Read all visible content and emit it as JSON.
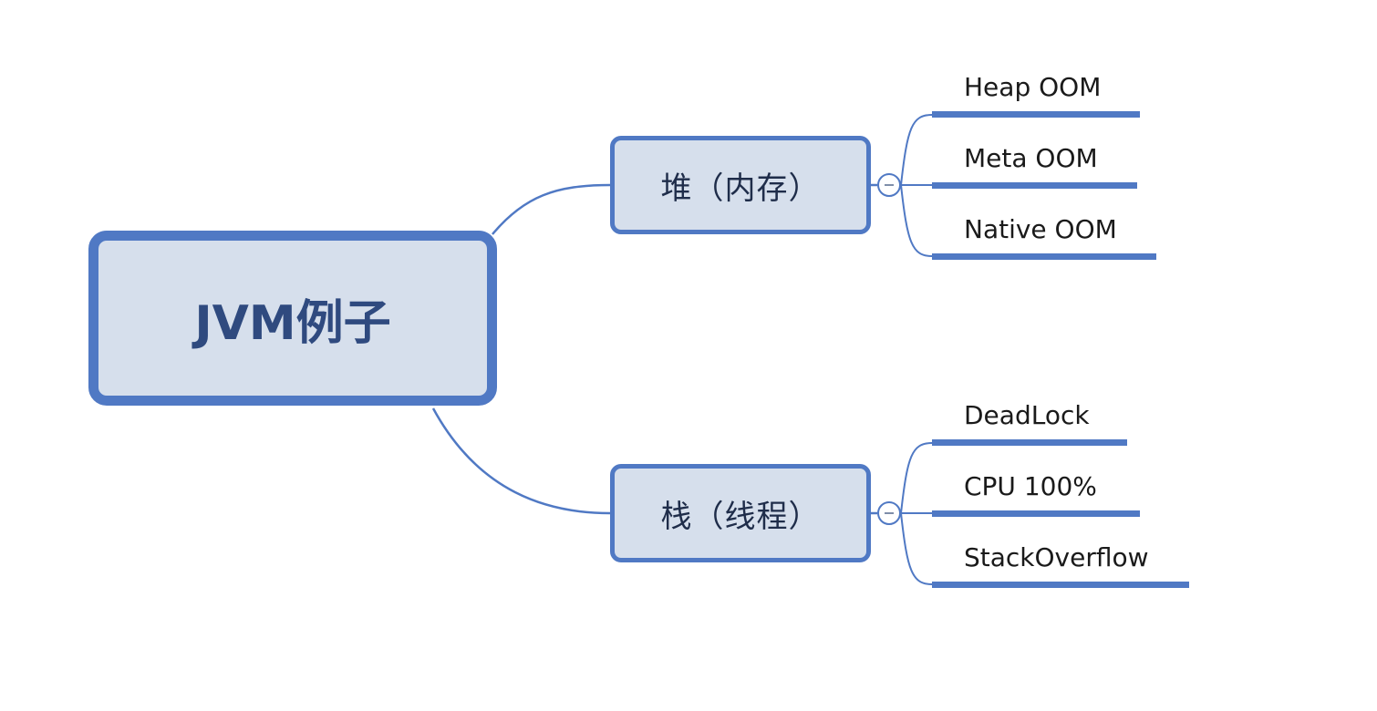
{
  "root": {
    "label": "JVM例子"
  },
  "branches": [
    {
      "label": "堆（内存）",
      "leaves": [
        "Heap OOM",
        "Meta OOM",
        "Native OOM"
      ]
    },
    {
      "label": "栈（线程）",
      "leaves": [
        "DeadLock",
        "CPU 100%",
        "StackOverflow"
      ]
    }
  ],
  "colors": {
    "node_fill": "#d6dfec",
    "node_border": "#5079c4",
    "connector": "#5079c4",
    "root_text": "#2f4a7f"
  }
}
